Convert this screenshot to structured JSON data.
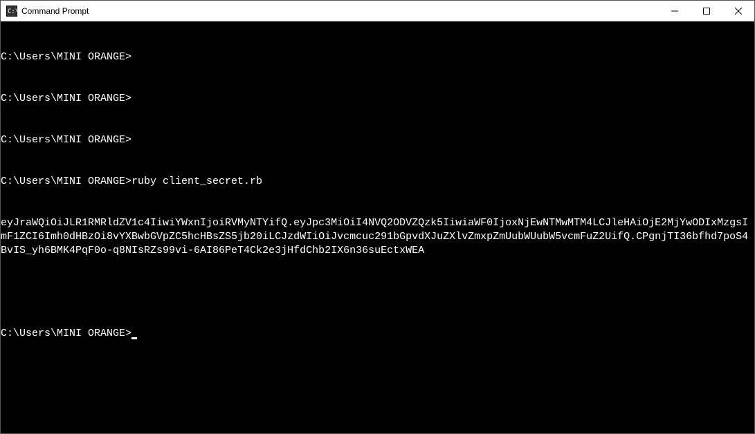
{
  "window": {
    "title": "Command Prompt"
  },
  "terminal": {
    "lines": [
      "C:\\Users\\MINI ORANGE>",
      "C:\\Users\\MINI ORANGE>",
      "C:\\Users\\MINI ORANGE>",
      "C:\\Users\\MINI ORANGE>ruby client_secret.rb",
      "eyJraWQiOiJLR1RMRldZV1c4IiwiYWxnIjoiRVMyNTYifQ.eyJpc3MiOiI4NVQ2ODVZQzk5IiwiaWF0IjoxNjEwNTMwMTM4LCJleHAiOjE2MjYwODIxMzgsImF1ZCI6Imh0dHBzOi8vYXBwbGVpZC5hcHBsZS5jb20iLCJzdWIiOiJvcmcuc291bGpvdXJuZXlvZmxpZmUubWUubW5vcmFuZ2UifQ.CPgnjTI36bfhd7poS4BvIS_yh6BMK4PqF0o-q8NIsRZs99vi-6AI86PeT4Ck2e3jHfdChb2IX6n36suEctxWEA"
    ],
    "prompt": "C:\\Users\\MINI ORANGE>"
  }
}
